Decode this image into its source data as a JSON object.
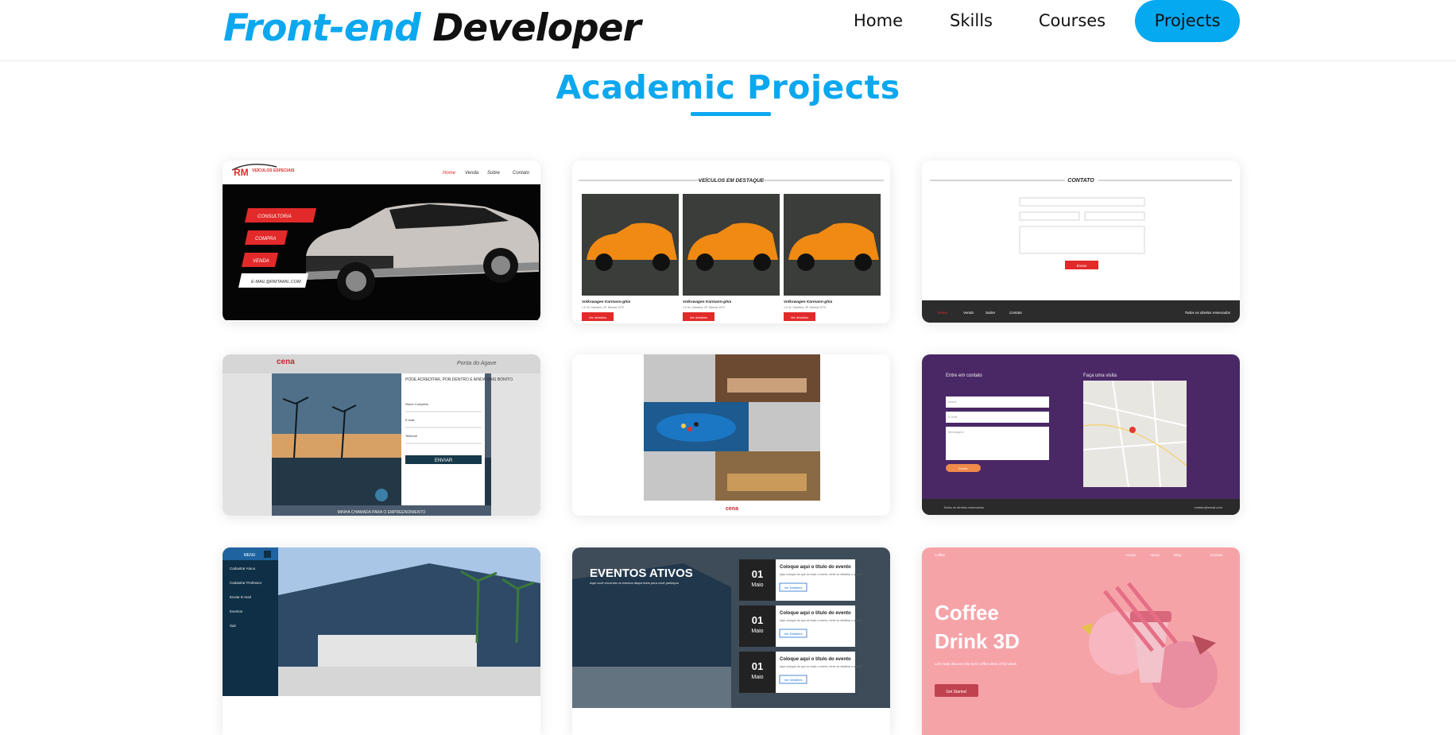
{
  "header": {
    "logo_part1": "Front-end",
    "logo_part2": "Developer",
    "nav": [
      {
        "label": "Home"
      },
      {
        "label": "Skills"
      },
      {
        "label": "Courses"
      },
      {
        "label": "Projects",
        "active": true
      }
    ]
  },
  "section": {
    "title": "Academic Projects"
  },
  "projects": {
    "p1": {
      "brand": "RM",
      "brand_sub": "VEÍCULOS ESPECIAIS",
      "nav": [
        "Home",
        "Venda",
        "Sobre",
        "Contato"
      ],
      "buttons": [
        "CONSULTORIA",
        "COMPRA",
        "VENDA",
        "E-MAIL@RMTAMIL.COM"
      ]
    },
    "p2": {
      "heading": "VEÍCULOS EM DESTAQUE",
      "car_name": "Volkswagen Karmann-ghia",
      "car_meta": "1.6 4v, Gasolina, 2P, Manual 1970",
      "button": "Ver detalhes"
    },
    "p3": {
      "heading": "CONTATO",
      "submit": "Enviar",
      "footer_nav": [
        "Home",
        "Venda",
        "Sobre",
        "Contato"
      ],
      "footer_right": "Todos os direitos reservados"
    },
    "p4": {
      "brand": "cena",
      "signature": "Ponta do Agave",
      "headline": "PODE ACREDITAR, POR DENTRO É AINDA MAIS BONITO.",
      "field1": "Nome Completo",
      "field2": "E-mail",
      "field3": "Telefone",
      "submit": "ENVIAR",
      "caption": "MINHA CHAMADA PARA O EMPREENDIMENTO"
    },
    "p5": {
      "brand": "cena"
    },
    "p6": {
      "heading1": "Entre em contato",
      "heading2": "Faça uma visita",
      "field1": "Nome",
      "field2": "E-mail",
      "field3": "Mensagem",
      "submit": "Enviar",
      "footer_left": "Todos os direitos reservados",
      "footer_right": "contato@email.com"
    },
    "p7": {
      "menu": "MENU",
      "items": [
        "Cadastrar Aluno",
        "Cadastrar Professor",
        "Enviar E-mail",
        "Eventos",
        "Sair"
      ]
    },
    "p8": {
      "heading": "EVENTOS ATIVOS",
      "subheading": "Aqui você encontra os eventos disponíveis para você participar",
      "day": "01",
      "month": "Maio",
      "event_title": "Coloque aqui o título do evento",
      "event_text": "Aqui coloque do que se trata o evento, tente se detalhar o quiser",
      "event_button": "Ver Detalhes"
    },
    "p9": {
      "nav": [
        "Home",
        "About",
        "Blog",
        "Contact"
      ],
      "brand": "Coffee",
      "title_line1": "Coffee",
      "title_line2": "Drink 3D",
      "tagline": "Let's help discover the best coffee drink of the week",
      "button": "Get Started"
    }
  }
}
